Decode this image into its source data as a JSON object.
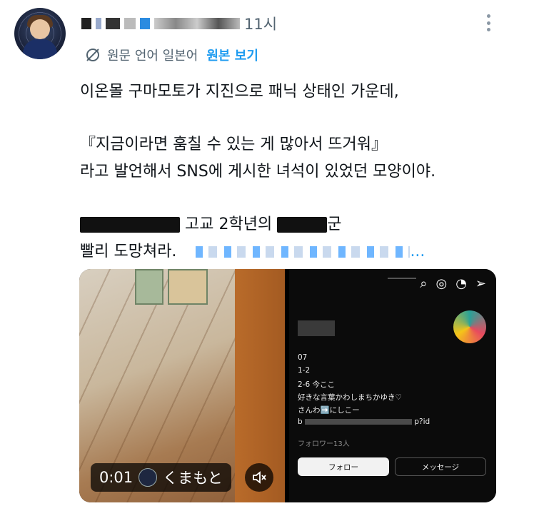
{
  "tweet": {
    "time": "11시",
    "translation": {
      "label": "원문 언어 일본어",
      "show_original": "원본 보기"
    },
    "lines": [
      "이온몰 구마모토가 지진으로 패닉 상태인 가운데,",
      "『지금이라면 훔칠 수 있는 게 많아서 뜨거워』",
      "라고 발언해서 SNS에 게시한 녀석이 있었던 모양이야.",
      "고교 2학년의",
      "군",
      "빨리 도망쳐라.",
      "..."
    ]
  },
  "video": {
    "elapsed": "0:01",
    "channel": "くまもと"
  },
  "instagram_profile": {
    "bio": [
      "07",
      "1-2",
      "2-6 今ここ",
      "好きな言葉かわしまちかゆき♡",
      "さんわ➡️にしこー",
      "b",
      "p?id"
    ],
    "followers": "フォロワー13人",
    "follow_label": "フォロー",
    "message_label": "メッセージ"
  }
}
